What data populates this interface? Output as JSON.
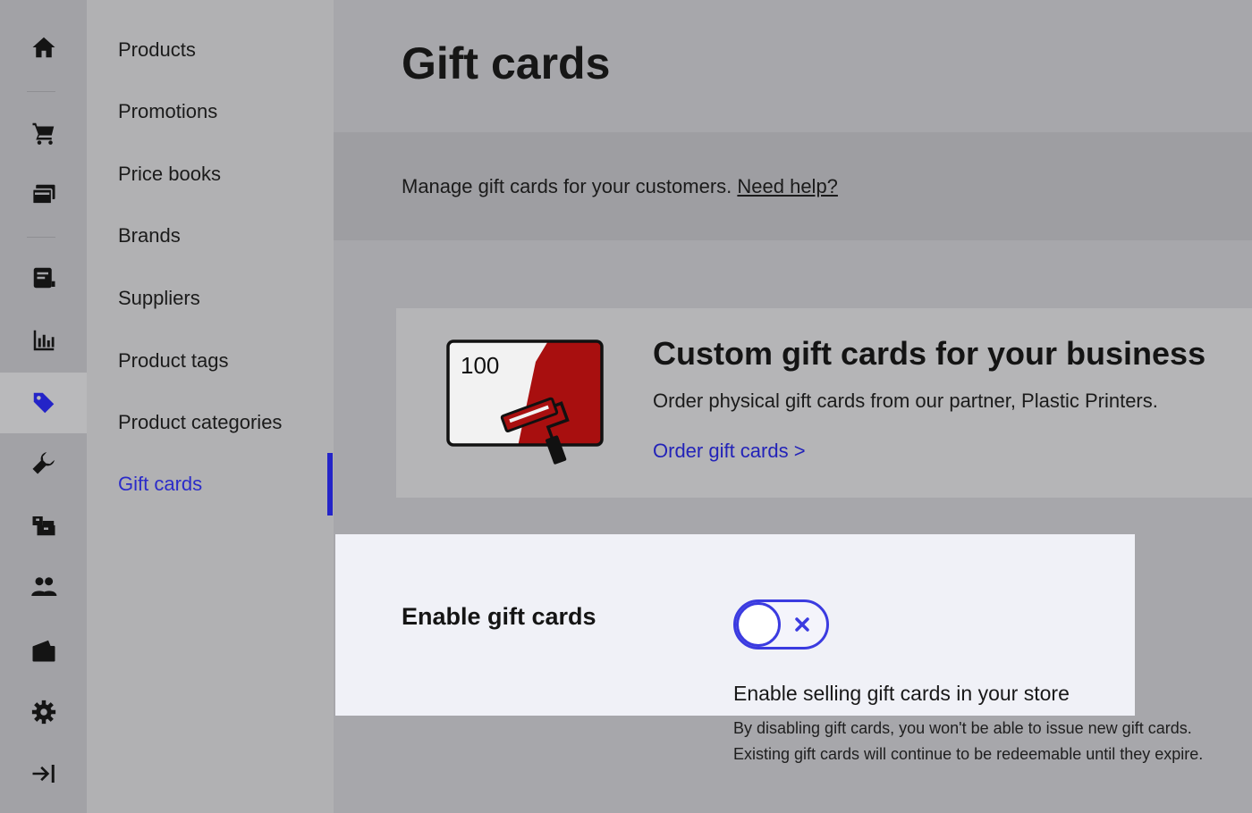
{
  "subnav": {
    "items": [
      {
        "label": "Products"
      },
      {
        "label": "Promotions"
      },
      {
        "label": "Price books"
      },
      {
        "label": "Brands"
      },
      {
        "label": "Suppliers"
      },
      {
        "label": "Product tags"
      },
      {
        "label": "Product categories"
      },
      {
        "label": "Gift cards",
        "active": true
      }
    ]
  },
  "rail": {
    "icons": [
      "home-icon",
      "cart-icon",
      "cards-icon",
      "receipt-icon",
      "chart-icon",
      "tag-icon",
      "wrench-icon",
      "boxes-icon",
      "users-icon",
      "wallet-icon",
      "gear-icon",
      "collapse-icon"
    ],
    "active": "tag-icon"
  },
  "header": {
    "title": "Gift cards"
  },
  "description": {
    "text": "Manage gift cards for your customers. ",
    "help_link": "Need help?"
  },
  "promo": {
    "card_value": "100",
    "title": "Custom gift cards for your business",
    "subtitle": "Order physical gift cards from our partner, Plastic Printers.",
    "link": "Order gift cards >"
  },
  "settings": {
    "label": "Enable gift cards",
    "toggle_enabled": false,
    "title": "Enable selling gift cards in your store",
    "help_line1": "By disabling gift cards, you won't be able to issue new gift cards.",
    "help_line2": "Existing gift cards will continue to be redeemable until they expire."
  },
  "colors": {
    "accent": "#2424c8",
    "link": "#2323b8",
    "promo_red": "#a80f0f"
  }
}
